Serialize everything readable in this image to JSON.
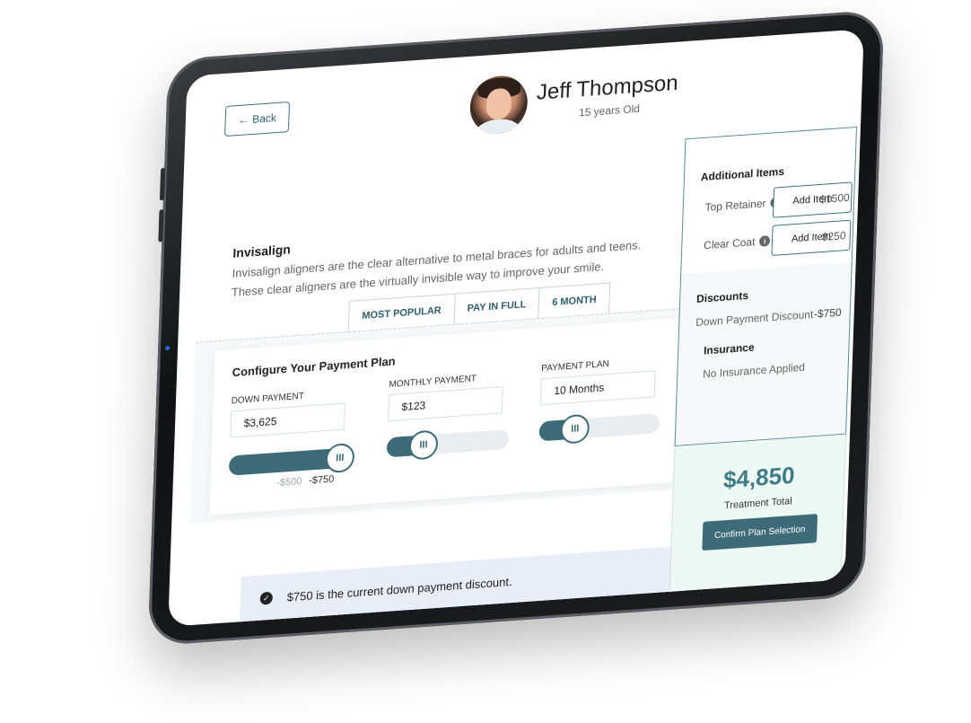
{
  "header": {
    "back_label": "Back",
    "patient_name": "Jeff Thompson",
    "patient_age": "15 years Old"
  },
  "product": {
    "title": "Invisalign",
    "description_line1": "Invisalign aligners are the clear alternative to metal braces for adults and teens.",
    "description_line2": "These clear aligners are the virtually invisible way to improve your smile."
  },
  "tabs": [
    {
      "label": "MOST POPULAR"
    },
    {
      "label": "PAY IN FULL"
    },
    {
      "label": "6 MONTH"
    }
  ],
  "payment_plan": {
    "title": "Configure Your Payment Plan",
    "down_payment": {
      "label": "DOWN PAYMENT",
      "value": "$3,625",
      "slider_level": 0.9,
      "range_min": "-$500",
      "range_max": "-$750"
    },
    "monthly_payment": {
      "label": "MONTHLY PAYMENT",
      "value": "$123",
      "slider_level": 0.3
    },
    "plan_length": {
      "label": "PAYMENT PLAN",
      "value": "10 Months",
      "slider_level": 0.3
    }
  },
  "notice": {
    "text": "$750 is the current down payment discount."
  },
  "additional_items": {
    "title": "Additional Items",
    "items": [
      {
        "label": "Top Retainer",
        "button": "Add Item",
        "price": "$1500"
      },
      {
        "label": "Clear Coat",
        "button": "Add Item",
        "price": "$250"
      }
    ]
  },
  "discounts": {
    "title": "Discounts",
    "down_payment_label": "Down Payment Discount",
    "down_payment_value": "-$750",
    "insurance_title": "Insurance",
    "insurance_status": "No Insurance Applied"
  },
  "total": {
    "amount": "$4,850",
    "label": "Treatment Total",
    "confirm_label": "Confirm Plan Selection"
  },
  "colors": {
    "accent": "#3e6b78",
    "total_text": "#3e7d85",
    "notice_bg": "#e8edf8",
    "slider_tail": "#6f9168"
  },
  "icons": {
    "back": "arrow-left-icon",
    "info": "info-icon",
    "check": "check-circle-icon",
    "slider_thumb": "grip-lines-icon"
  }
}
